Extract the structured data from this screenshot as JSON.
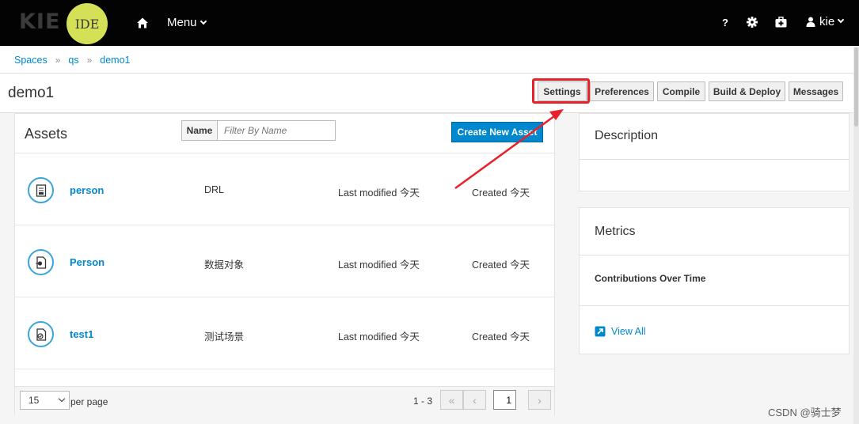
{
  "topbar": {
    "logo_kie": "KIE",
    "logo_ide": "IDE",
    "menu_label": "Menu",
    "help_label": "?",
    "user_label": "kie"
  },
  "breadcrumb": [
    "Spaces",
    "qs",
    "demo1"
  ],
  "title": "demo1",
  "toolbar": {
    "settings": "Settings",
    "preferences": "Preferences",
    "compile": "Compile",
    "build_deploy": "Build & Deploy",
    "messages": "Messages"
  },
  "assets": {
    "title": "Assets",
    "filter_label": "Name",
    "filter_placeholder": "Filter By Name",
    "create_button": "Create New Asset",
    "rows": [
      {
        "name": "person",
        "type": "DRL",
        "modified": "Last modified 今天",
        "created": "Created 今天"
      },
      {
        "name": "Person",
        "type": "数据对象",
        "modified": "Last modified 今天",
        "created": "Created 今天"
      },
      {
        "name": "test1",
        "type": "测试场景",
        "modified": "Last modified 今天",
        "created": "Created 今天"
      }
    ],
    "pager": {
      "per_page_value": "15",
      "per_page_label": "per page",
      "range": "1 - 3",
      "first": "«",
      "prev": "‹",
      "page_value": "1",
      "next": "›"
    }
  },
  "description": {
    "title": "Description"
  },
  "metrics": {
    "title": "Metrics",
    "subtitle": "Contributions Over Time",
    "view_all": "View All"
  },
  "watermark": "CSDN @骑士梦",
  "colors": {
    "accent": "#0088ce",
    "highlight": "#e8202a",
    "logo_circle": "#d4e157"
  }
}
